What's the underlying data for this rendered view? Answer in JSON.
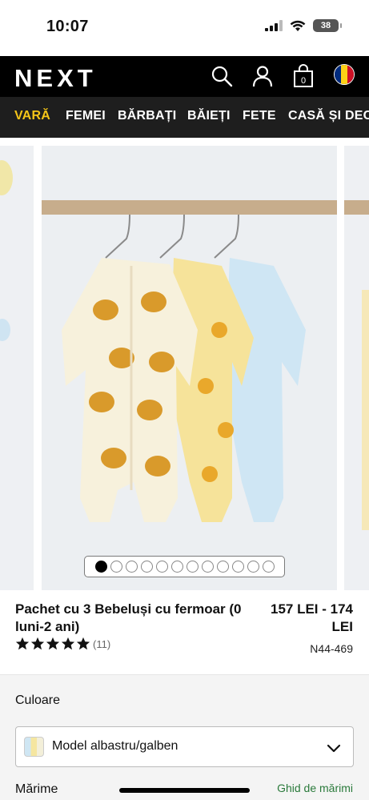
{
  "status_bar": {
    "time": "10:07",
    "battery": "38"
  },
  "header": {
    "logo": "NEXT"
  },
  "nav": {
    "categories": [
      {
        "label": "VARĂ",
        "active": true
      },
      {
        "label": "FEMEI",
        "active": false
      },
      {
        "label": "BĂRBAȚI",
        "active": false
      },
      {
        "label": "BĂIEȚI",
        "active": false
      },
      {
        "label": "FETE",
        "active": false
      },
      {
        "label": "CASĂ ȘI DECOR",
        "active": false
      }
    ]
  },
  "gallery": {
    "total_images": 12,
    "current_index": 1
  },
  "product": {
    "title": "Pachet cu 3 Bebeluși cu fermoar (0 luni-2 ani)",
    "price": "157 LEI - 174 LEI",
    "rating": 5,
    "review_count": "(11)",
    "sku": "N44-469"
  },
  "options": {
    "color_label": "Culoare",
    "color_value": "Model albastru/galben",
    "size_label": "Mărime",
    "size_guide": "Ghid de mărimi"
  },
  "colors": {
    "accent_yellow": "#f5c518",
    "nav_black": "#000000",
    "link_green": "#2a7a3b"
  }
}
